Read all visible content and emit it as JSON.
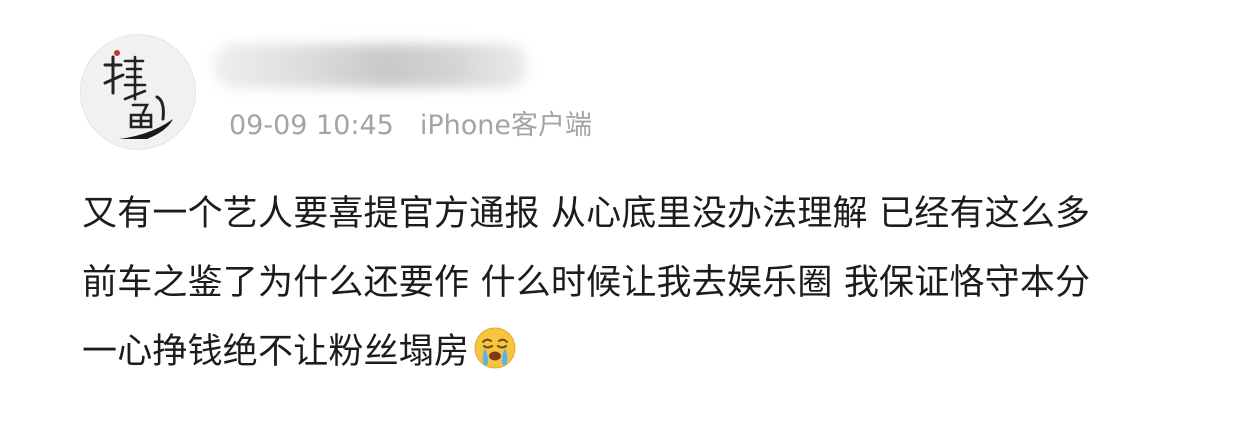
{
  "post": {
    "avatar_icon": "calligraphy-avatar-icon",
    "avatar_text": "摸鱼",
    "username": "",
    "time": "09-09 10:45",
    "source": "iPhone客户端",
    "content_lines": [
      "又有一个艺人要喜提官方通报 从心底里没办法理解 已经有这么多",
      "前车之鉴了为什么还要作 什么时候让我去娱乐圈 我保证恪守本分",
      "一心挣钱绝不让粉丝塌房"
    ],
    "emoji_icon": "crying-face-emoji-icon"
  },
  "colors": {
    "text": "#1c1c1c",
    "meta": "#a4a4a4",
    "emoji": "#f5c542"
  }
}
